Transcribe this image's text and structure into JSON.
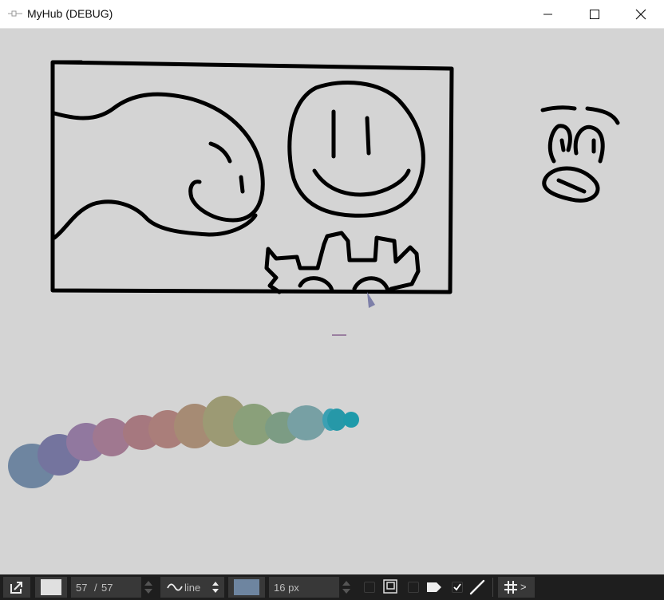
{
  "window": {
    "title": "MyHub (DEBUG)"
  },
  "toolbar": {
    "current_color": "#e0e0e0",
    "page_current": "57",
    "page_separator": "/",
    "page_total": "57",
    "stroke_mode": "line",
    "brush_color": "#6e85a0",
    "brush_size": "16 px",
    "grid_label": ">"
  },
  "colors": {
    "background": "#d4d4d4",
    "toolbar": "#1e1e1e",
    "ink": "#000000"
  }
}
